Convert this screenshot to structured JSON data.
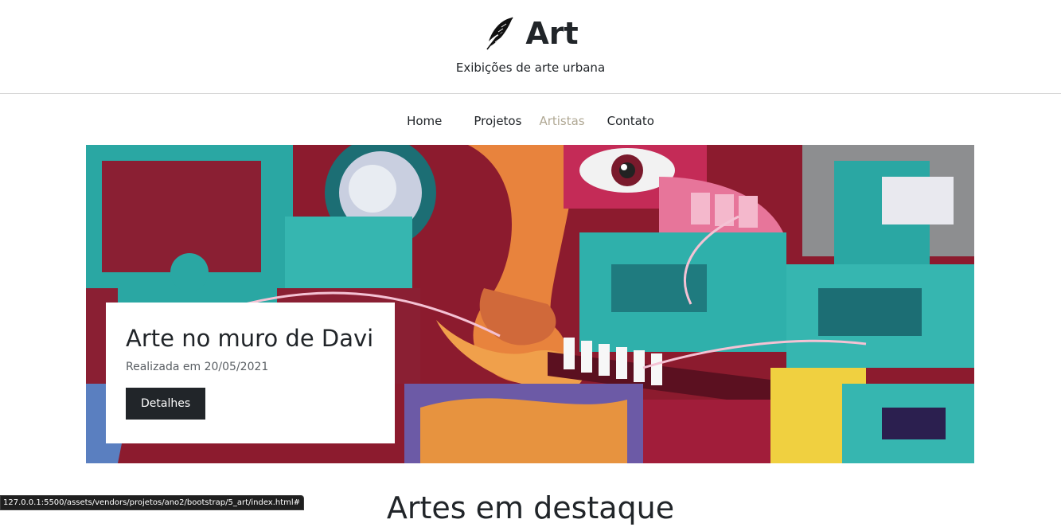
{
  "header": {
    "brand_icon": "feather-quill-icon",
    "title": "Art",
    "subtitle": "Exibições de arte urbana"
  },
  "nav": {
    "items": [
      {
        "label": "Home",
        "active": false
      },
      {
        "label": "Projetos",
        "active": false
      },
      {
        "label": "Artistas",
        "active": true
      },
      {
        "label": "Contato",
        "active": false
      }
    ]
  },
  "hero": {
    "image": "street-art-graffiti-mural",
    "card": {
      "title": "Arte no muro de Davi",
      "date": "Realizada em 20/05/2021",
      "button_label": "Detalhes"
    }
  },
  "featured": {
    "heading": "Artes em destaque"
  },
  "status_bar": {
    "url": "127.0.0.1:5500/assets/vendors/projetos/ano2/bootstrap/5_art/index.html#"
  },
  "colors": {
    "text": "#212529",
    "nav_active": "#b0a894",
    "button_bg": "#212529",
    "button_text": "#ffffff",
    "divider": "#d6d6d6"
  }
}
